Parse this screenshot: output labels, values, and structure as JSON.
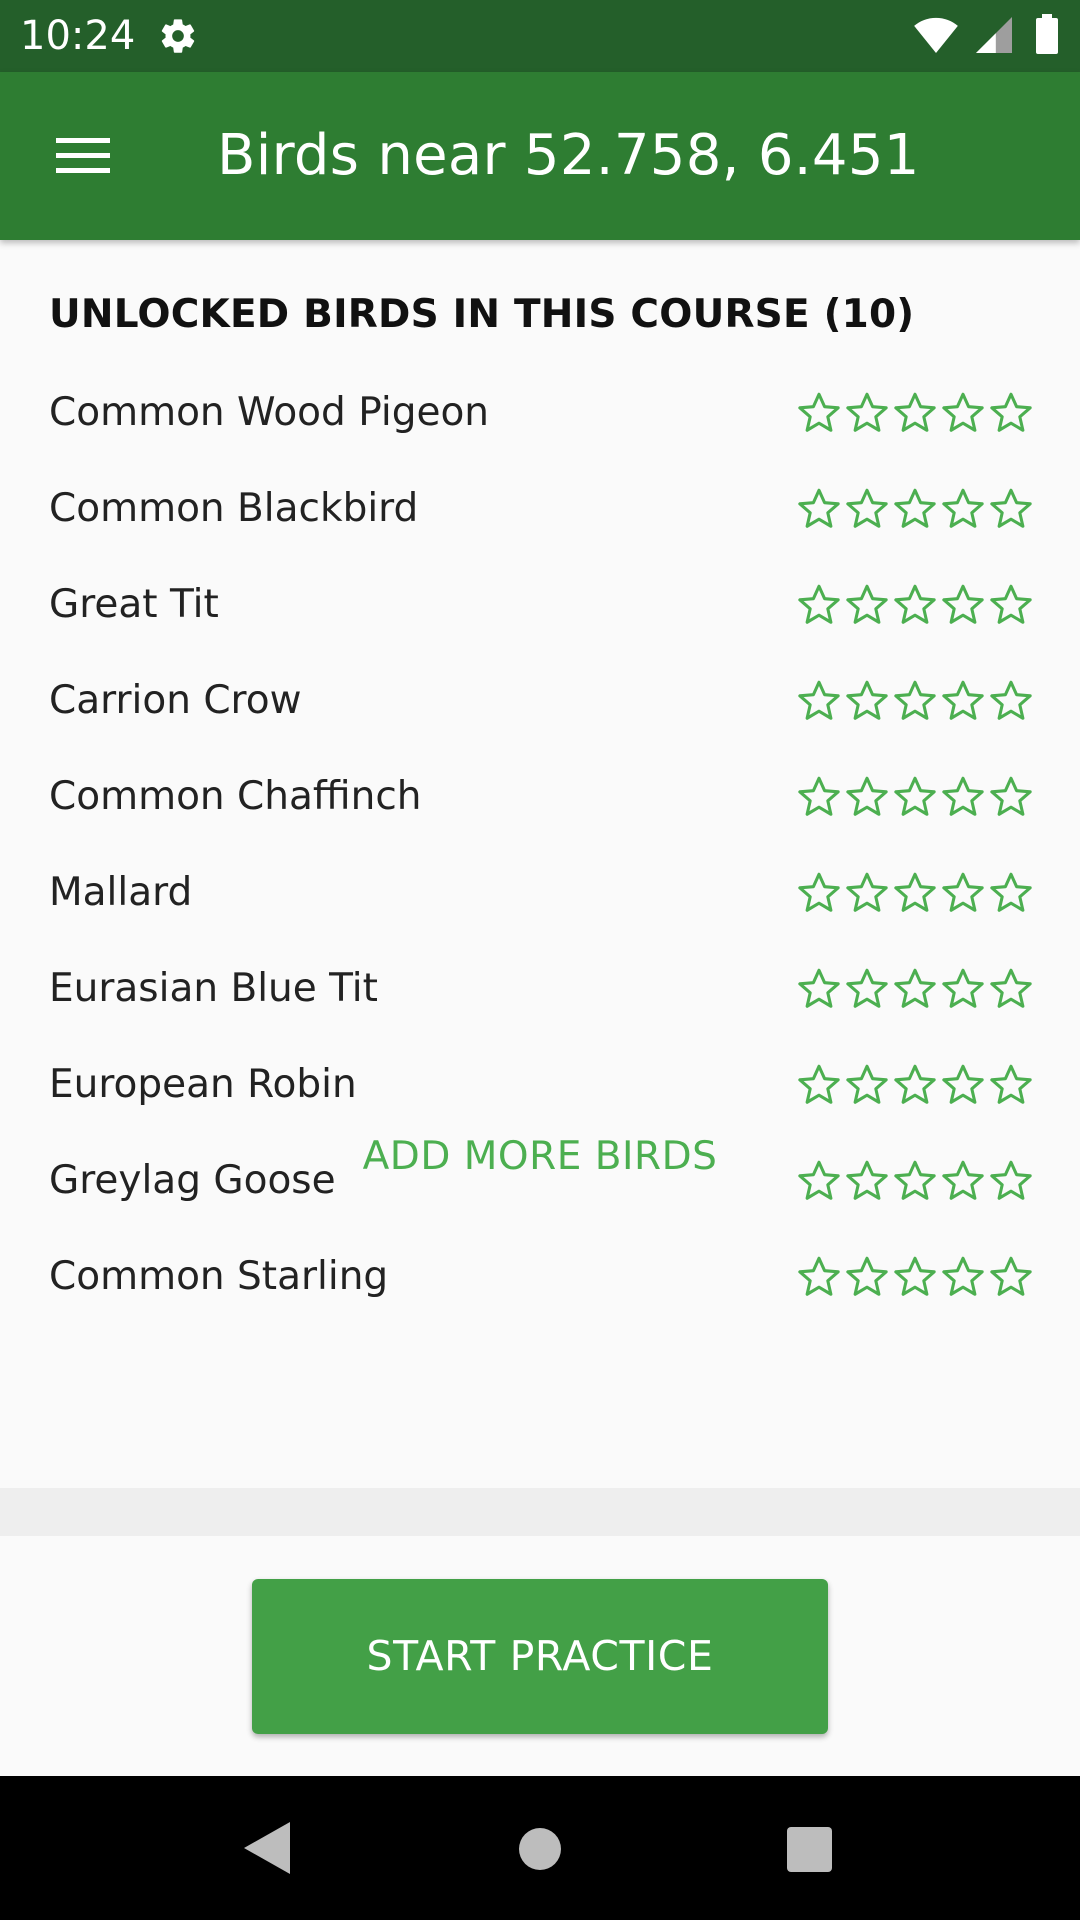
{
  "status_bar": {
    "time": "10:24",
    "icons": [
      "gear-icon",
      "wifi-icon",
      "signal-icon",
      "battery-icon"
    ]
  },
  "app_bar": {
    "title": "Birds near 52.758, 6.451",
    "menu_icon": "hamburger-menu-icon",
    "color": "#2e7d32"
  },
  "section": {
    "header": "UNLOCKED BIRDS IN THIS COURSE (10)"
  },
  "birds": [
    {
      "name": "Common Wood Pigeon",
      "stars": 0
    },
    {
      "name": "Common Blackbird",
      "stars": 0
    },
    {
      "name": "Great Tit",
      "stars": 0
    },
    {
      "name": "Carrion Crow",
      "stars": 0
    },
    {
      "name": "Common Chaffinch",
      "stars": 0
    },
    {
      "name": "Mallard",
      "stars": 0
    },
    {
      "name": "Eurasian Blue Tit",
      "stars": 0
    },
    {
      "name": "European Robin",
      "stars": 0
    },
    {
      "name": "Greylag Goose",
      "stars": 0
    },
    {
      "name": "Common Starling",
      "stars": 0
    }
  ],
  "max_stars": 5,
  "star_color": "#4caf50",
  "add_more_label": "ADD MORE BIRDS",
  "start_practice_label": "START PRACTICE",
  "accent_color": "#43a047",
  "nav_bar": {
    "icons": [
      "back-icon",
      "home-icon",
      "recent-apps-icon"
    ]
  }
}
